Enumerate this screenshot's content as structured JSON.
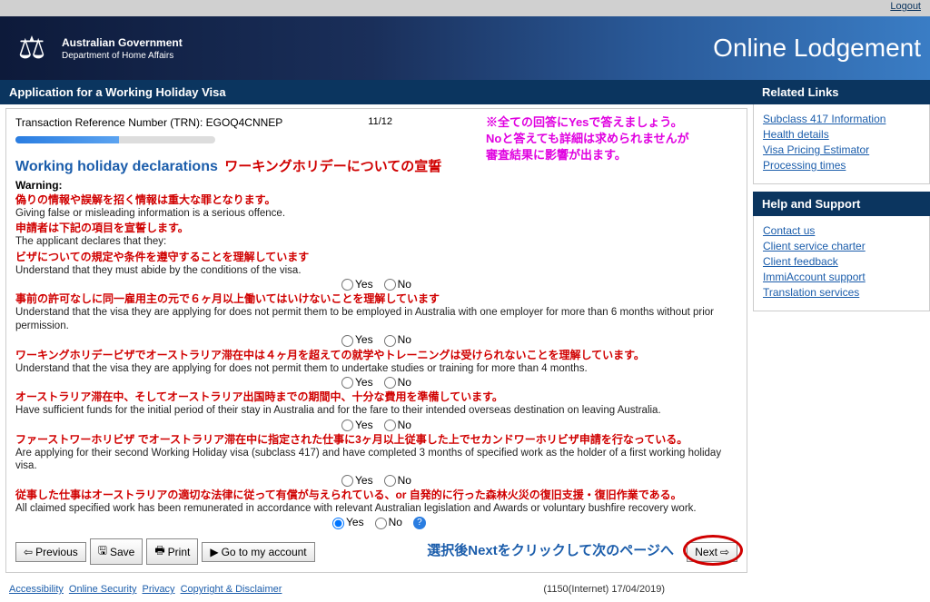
{
  "header": {
    "gov": "Australian Government",
    "dept": "Department of Home Affairs",
    "title": "Online Lodgement",
    "logout": "Logout"
  },
  "app": {
    "title": "Application for a Working Holiday Visa",
    "trn_label": "Transaction Reference Number (TRN): EGOQ4CNNEP",
    "progress": "11/12"
  },
  "annot": {
    "top1": "※全ての回答にYesで答えましょう。",
    "top2": "Noと答えても詳細は求められませんが",
    "top3": "審査結果に影響が出ます。",
    "next": "選択後Nextをクリックして次のページへ"
  },
  "section": {
    "title_en": "Working holiday declarations",
    "title_jp": "ワーキングホリデーについての宣誓",
    "warning": "Warning:"
  },
  "decl": [
    {
      "jp": "偽りの情報や誤解を招く情報は重大な罪となります。",
      "en": "Giving false or misleading information is a serious offence.",
      "radio": false
    },
    {
      "jp": "申請者は下記の項目を宣誓します。",
      "en": "The applicant declares that they:",
      "radio": false
    },
    {
      "jp": "ビザについての規定や条件を遵守することを理解しています",
      "en": "Understand that they must abide by the conditions of the visa.",
      "radio": true
    },
    {
      "jp": "事前の許可なしに同一雇用主の元で６ヶ月以上働いてはいけないことを理解しています",
      "en": "Understand that the visa they are applying for does not permit them to be employed in Australia with one employer for more than 6 months without prior permission.",
      "radio": true
    },
    {
      "jp": "ワーキングホリデービザでオーストラリア滞在中は４ヶ月を超えての就学やトレーニングは受けられないことを理解しています。",
      "en": "Understand that the visa they are applying for does not permit them to undertake studies or training for more than 4 months.",
      "radio": true
    },
    {
      "jp": "オーストラリア滞在中、そしてオーストラリア出国時までの期間中、十分な費用を準備しています。",
      "en": "Have sufficient funds for the initial period of their stay in Australia and for the fare to their intended overseas destination on leaving Australia.",
      "radio": true
    },
    {
      "jp": "ファーストワーホリビザ でオーストラリア滞在中に指定された仕事に3ヶ月以上従事した上でセカンドワーホリビザ申請を行なっている。",
      "en": "Are applying for their second Working Holiday visa (subclass 417) and have completed 3 months of specified work as the holder of a first working holiday visa.",
      "radio": true
    },
    {
      "jp": "従事した仕事はオーストラリアの適切な法律に従って有償が与えられている、or  自発的に行った森林火災の復旧支援・復旧作業である。",
      "en": "All claimed specified work has been remunerated in accordance with relevant Australian legislation and Awards or voluntary bushfire recovery work.",
      "radio": true,
      "help": true,
      "checked": true
    }
  ],
  "radio_labels": {
    "yes": "Yes",
    "no": "No"
  },
  "buttons": {
    "previous": "Previous",
    "save": "Save",
    "print": "Print",
    "account": "Go to my account",
    "next": "Next"
  },
  "sidebar": {
    "related": {
      "title": "Related Links",
      "links": [
        "Subclass 417 Information",
        "Health details",
        "Visa Pricing Estimator",
        "Processing times"
      ]
    },
    "help": {
      "title": "Help and Support",
      "links": [
        "Contact us",
        "Client service charter",
        "Client feedback",
        "ImmiAccount support",
        "Translation services"
      ]
    }
  },
  "footer": {
    "links": [
      "Accessibility",
      "Online Security",
      "Privacy",
      "Copyright & Disclaimer"
    ],
    "stamp": "(1150(Internet) 17/04/2019)"
  }
}
